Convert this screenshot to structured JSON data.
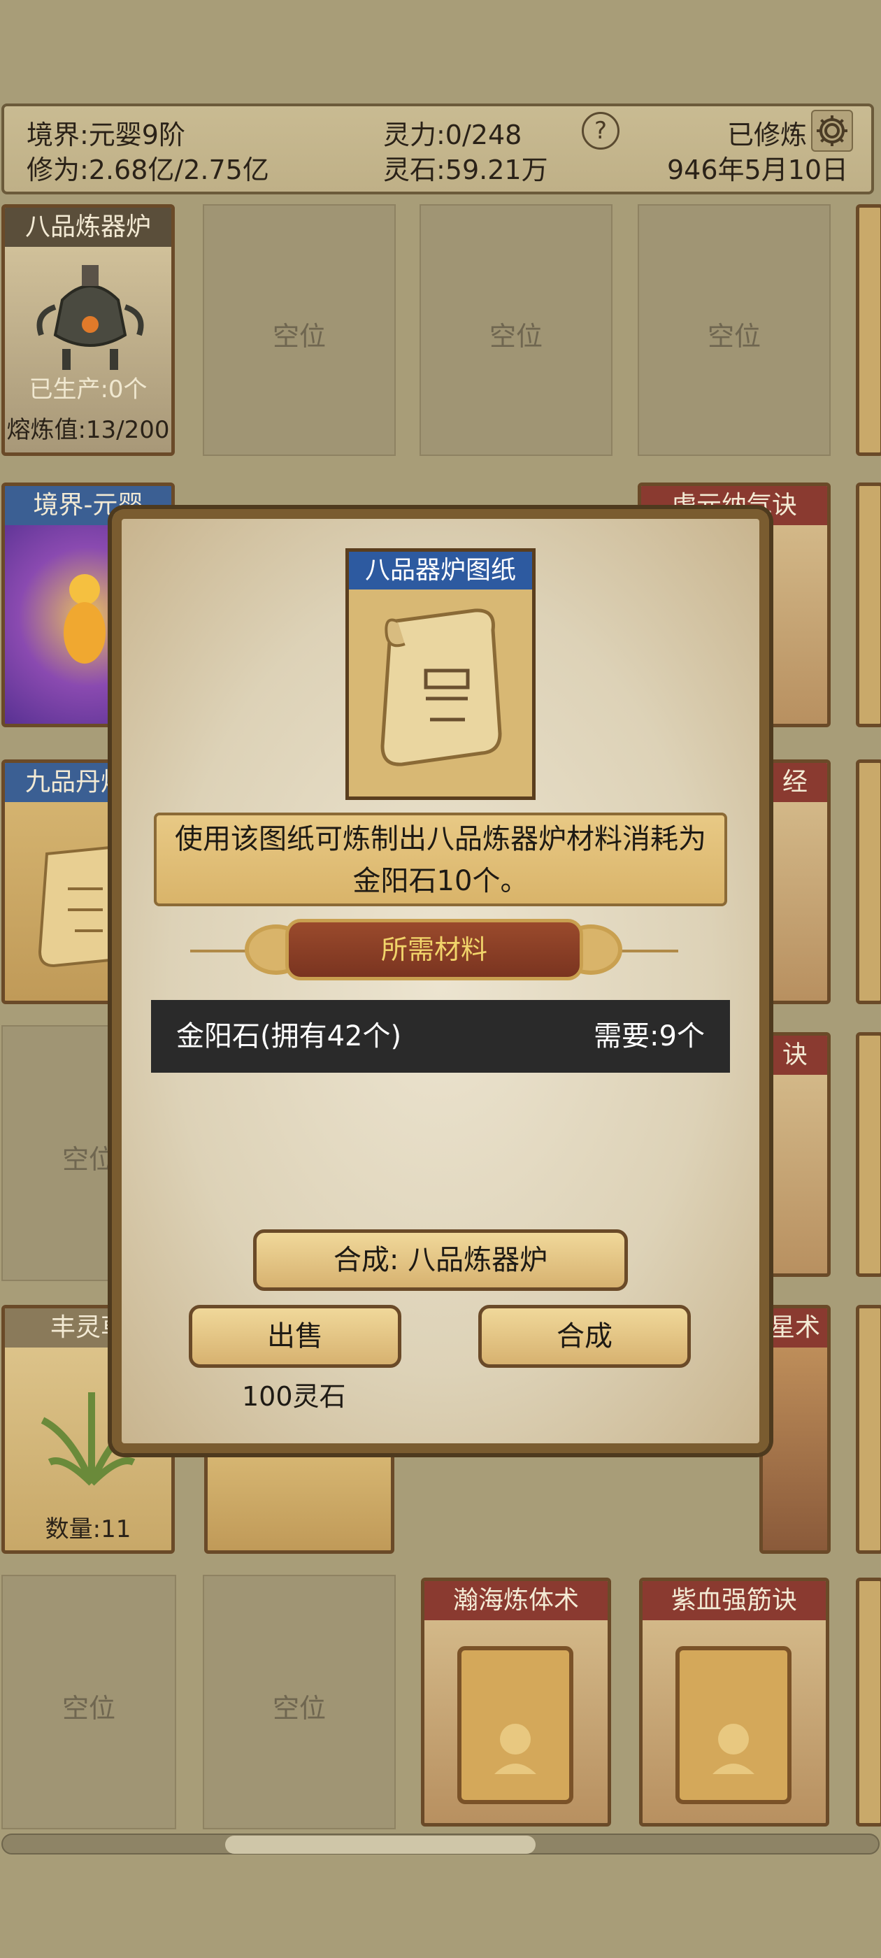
{
  "header": {
    "realm": "境界:元婴9阶",
    "cultivation": "修为:2.68亿/2.75亿",
    "spirit_power": "灵力:0/248",
    "spirit_stone": "灵石:59.21万",
    "help_symbol": "?",
    "status": "已修炼",
    "date": "946年5月10日"
  },
  "grid": {
    "furnace": {
      "title": "八品炼器炉",
      "produced": "已生产:0个",
      "smelt": "熔炼值:13/200"
    },
    "empty_label": "空位",
    "realm_card": {
      "title": "境界-元婴"
    },
    "pill_card": {
      "title": "九品丹炉图"
    },
    "card_r2c4": {
      "title": "虚元纳气诀"
    },
    "card_r3c4": {
      "title": "经"
    },
    "card_r4c4": {
      "title": "诀"
    },
    "card_r5c4": {
      "title": "星术"
    },
    "herb": {
      "title": "丰灵草",
      "count": "数量:11"
    },
    "book1": {
      "title": "瀚海炼体术"
    },
    "book2": {
      "title": "紫血强筋诀"
    }
  },
  "modal": {
    "card_title": "八品器炉图纸",
    "description": "使用该图纸可炼制出八品炼器炉材料消耗为金阳石10个。",
    "materials_title": "所需材料",
    "material_name": "金阳石(拥有42个)",
    "material_need": "需要:9个",
    "craft_target": "合成: 八品炼器炉",
    "sell_label": "出售",
    "craft_label": "合成",
    "sell_price": "100灵石"
  },
  "colors": {
    "background": "#a89d78",
    "title_blue": "#3b5f93",
    "title_red": "#8a3a30",
    "banner": "#8a3e24",
    "gold_text": "#f1d46a"
  }
}
